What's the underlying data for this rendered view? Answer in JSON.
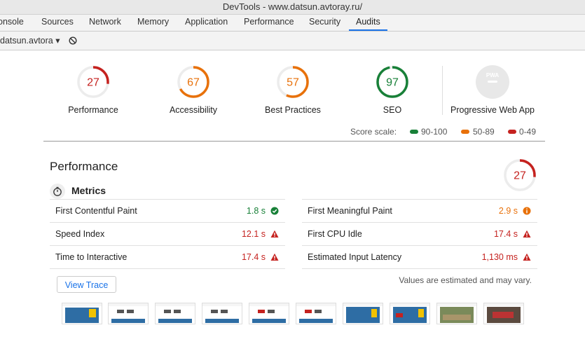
{
  "window": {
    "title": "DevTools - www.datsun.avtoray.ru/"
  },
  "tabs": [
    {
      "label": "onsole"
    },
    {
      "label": "Sources"
    },
    {
      "label": "Network"
    },
    {
      "label": "Memory"
    },
    {
      "label": "Application"
    },
    {
      "label": "Performance"
    },
    {
      "label": "Security"
    },
    {
      "label": "Audits",
      "active": true
    }
  ],
  "subtoolbar": {
    "target": "datsun.avtora ▾"
  },
  "categories": [
    {
      "label": "Performance",
      "score": "27",
      "value": 27,
      "color": "#c5221f"
    },
    {
      "label": "Accessibility",
      "score": "67",
      "value": 67,
      "color": "#e8710a"
    },
    {
      "label": "Best Practices",
      "score": "57",
      "value": 57,
      "color": "#e8710a"
    },
    {
      "label": "SEO",
      "score": "97",
      "value": 97,
      "color": "#188038"
    },
    {
      "label": "Progressive Web App",
      "badge": "PWA"
    }
  ],
  "score_scale": {
    "label": "Score scale:",
    "ranges": [
      {
        "label": "90-100",
        "color": "#188038"
      },
      {
        "label": "50-89",
        "color": "#e8710a"
      },
      {
        "label": "0-49",
        "color": "#c5221f"
      }
    ]
  },
  "performance": {
    "title": "Performance",
    "score": "27",
    "value": 27,
    "metrics_title": "Metrics",
    "metrics": [
      {
        "name": "First Contentful Paint",
        "value": "1.8 s",
        "status": "pass",
        "color": "#188038"
      },
      {
        "name": "First Meaningful Paint",
        "value": "2.9 s",
        "status": "average",
        "color": "#e8710a"
      },
      {
        "name": "Speed Index",
        "value": "12.1 s",
        "status": "fail",
        "color": "#c5221f"
      },
      {
        "name": "First CPU Idle",
        "value": "17.4 s",
        "status": "fail",
        "color": "#c5221f"
      },
      {
        "name": "Time to Interactive",
        "value": "17.4 s",
        "status": "fail",
        "color": "#c5221f"
      },
      {
        "name": "Estimated Input Latency",
        "value": "1,130 ms",
        "status": "fail",
        "color": "#c5221f"
      }
    ],
    "view_trace_label": "View Trace",
    "note": "Values are estimated and may vary."
  }
}
